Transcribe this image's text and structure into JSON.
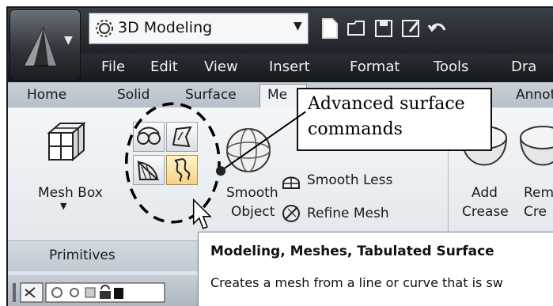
{
  "workspace": {
    "name": "3D Modeling"
  },
  "menu": [
    "File",
    "Edit",
    "View",
    "Insert",
    "Format",
    "Tools",
    "Dra"
  ],
  "tabs": [
    "Home",
    "Solid",
    "Surface",
    "Me",
    "Annot"
  ],
  "ribbon": {
    "mesh_box": {
      "line1": "Mesh Box"
    },
    "smooth_object": {
      "line1": "Smooth",
      "line2": "Object"
    },
    "smooth_less": "Smooth Less",
    "refine_mesh": "Refine Mesh",
    "add_crease": {
      "line1": "Add",
      "line2": "Crease"
    },
    "remove_crease": {
      "line1": "Rem",
      "line2": "Cre"
    },
    "panel_title": "Primitives"
  },
  "callout": {
    "line1": "Advanced surface",
    "line2": "commands"
  },
  "tooltip": {
    "title": "Modeling, Meshes, Tabulated Surface",
    "description": "Creates a mesh from a line or curve that is sw"
  },
  "colors": {
    "menubar": "#1f2328",
    "ribbon": "#eef1f4",
    "highlight": "#f4d28a"
  }
}
